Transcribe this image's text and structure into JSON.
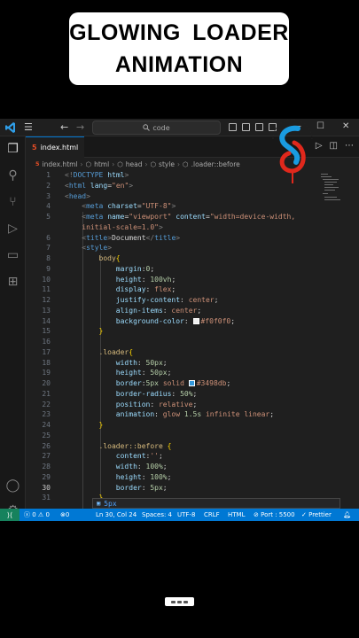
{
  "title": {
    "line1": "GLOWING  LOADER",
    "line2": "ANIMATION"
  },
  "titlebar": {
    "search_text": "code",
    "nav_back": "←",
    "nav_forward": "→"
  },
  "tab": {
    "label": "index.html",
    "icon": "html-file-icon"
  },
  "breadcrumb": [
    "index.html",
    "html",
    "head",
    "style",
    ".loader::before"
  ],
  "editor": {
    "lines": [
      {
        "n": "1",
        "cls": "",
        "html": "<span class=\"t-br\">&lt;!</span><span class=\"t-tag\">DOCTYPE</span> <span class=\"t-attr\">html</span><span class=\"t-br\">&gt;</span>"
      },
      {
        "n": "2",
        "cls": "",
        "html": "<span class=\"t-br\">&lt;</span><span class=\"t-tag\">html</span> <span class=\"t-attr\">lang</span><span class=\"t-txt\">=</span><span class=\"t-str\">\"en\"</span><span class=\"t-br\">&gt;</span>"
      },
      {
        "n": "3",
        "cls": "",
        "html": "<span class=\"t-br\">&lt;</span><span class=\"t-tag\">head</span><span class=\"t-br\">&gt;</span>"
      },
      {
        "n": "4",
        "cls": "",
        "html": "    <span class=\"t-br\">&lt;</span><span class=\"t-tag\">meta</span> <span class=\"t-attr\">charset</span><span class=\"t-txt\">=</span><span class=\"t-str\">\"UTF-8\"</span><span class=\"t-br\">&gt;</span>"
      },
      {
        "n": "5",
        "cls": "",
        "html": "    <span class=\"t-br\">&lt;</span><span class=\"t-tag\">meta</span> <span class=\"t-attr\">name</span><span class=\"t-txt\">=</span><span class=\"t-str\">\"viewport\"</span> <span class=\"t-attr\">content</span><span class=\"t-txt\">=</span><span class=\"t-str\">\"width=device-width,</span>"
      },
      {
        "n": "",
        "cls": "",
        "html": "    <span class=\"t-str\">initial-scale=1.0\"</span><span class=\"t-br\">&gt;</span>"
      },
      {
        "n": "6",
        "cls": "",
        "html": "    <span class=\"t-br\">&lt;</span><span class=\"t-tag\">title</span><span class=\"t-br\">&gt;</span><span class=\"t-txt\">Document</span><span class=\"t-br\">&lt;/</span><span class=\"t-tag\">title</span><span class=\"t-br\">&gt;</span>"
      },
      {
        "n": "7",
        "cls": "",
        "html": "    <span class=\"t-br\">&lt;</span><span class=\"t-tag\">style</span><span class=\"t-br\">&gt;</span>"
      },
      {
        "n": "8",
        "cls": "",
        "html": "        <span class=\"t-sel\">body</span><span class=\"t-brace\">{</span>"
      },
      {
        "n": "9",
        "cls": "",
        "html": "            <span class=\"t-prop\">margin</span><span class=\"t-txt\">:</span><span class=\"t-num\">0</span><span class=\"t-txt\">;</span>"
      },
      {
        "n": "10",
        "cls": "",
        "html": "            <span class=\"t-prop\">height</span><span class=\"t-txt\">: </span><span class=\"t-num\">100vh</span><span class=\"t-txt\">;</span>"
      },
      {
        "n": "11",
        "cls": "",
        "html": "            <span class=\"t-prop\">display</span><span class=\"t-txt\">: </span><span class=\"t-val\">flex</span><span class=\"t-txt\">;</span>"
      },
      {
        "n": "12",
        "cls": "",
        "html": "            <span class=\"t-prop\">justify-content</span><span class=\"t-txt\">: </span><span class=\"t-val\">center</span><span class=\"t-txt\">;</span>"
      },
      {
        "n": "13",
        "cls": "",
        "html": "            <span class=\"t-prop\">align-items</span><span class=\"t-txt\">: </span><span class=\"t-val\">center</span><span class=\"t-txt\">;</span>"
      },
      {
        "n": "14",
        "cls": "",
        "html": "            <span class=\"t-prop\">background-color</span><span class=\"t-txt\">: </span><span class=\"swatch\" style=\"background:#f0f0f0\"></span><span class=\"t-val\">#f0f0f0</span><span class=\"t-txt\">;</span>"
      },
      {
        "n": "15",
        "cls": "",
        "html": "        <span class=\"t-brace\">}</span>"
      },
      {
        "n": "16",
        "cls": "",
        "html": ""
      },
      {
        "n": "17",
        "cls": "",
        "html": "        <span class=\"t-sel\">.loader</span><span class=\"t-brace\">{</span>"
      },
      {
        "n": "18",
        "cls": "",
        "html": "            <span class=\"t-prop\">width</span><span class=\"t-txt\">: </span><span class=\"t-num\">50px</span><span class=\"t-txt\">;</span>"
      },
      {
        "n": "19",
        "cls": "",
        "html": "            <span class=\"t-prop\">height</span><span class=\"t-txt\">: </span><span class=\"t-num\">50px</span><span class=\"t-txt\">;</span>"
      },
      {
        "n": "20",
        "cls": "",
        "html": "            <span class=\"t-prop\">border</span><span class=\"t-txt\">:</span><span class=\"t-num\">5px</span> <span class=\"t-val\">solid</span> <span class=\"swatch\" style=\"background:#3498db\"></span><span class=\"t-val\">#3498db</span><span class=\"t-txt\">;</span>"
      },
      {
        "n": "21",
        "cls": "",
        "html": "            <span class=\"t-prop\">border-radius</span><span class=\"t-txt\">: </span><span class=\"t-num\">50%</span><span class=\"t-txt\">;</span>"
      },
      {
        "n": "22",
        "cls": "",
        "html": "            <span class=\"t-prop\">position</span><span class=\"t-txt\">: </span><span class=\"t-val\">relative</span><span class=\"t-txt\">;</span>"
      },
      {
        "n": "23",
        "cls": "",
        "html": "            <span class=\"t-prop\">animation</span><span class=\"t-txt\">: </span><span class=\"t-val\">glow</span> <span class=\"t-num\">1.5s</span> <span class=\"t-val\">infinite</span> <span class=\"t-val\">linear</span><span class=\"t-txt\">;</span>"
      },
      {
        "n": "24",
        "cls": "",
        "html": "        <span class=\"t-brace\">}</span>"
      },
      {
        "n": "25",
        "cls": "",
        "html": ""
      },
      {
        "n": "26",
        "cls": "",
        "html": "        <span class=\"t-sel\">.loader::before</span> <span class=\"t-brace\">{</span>"
      },
      {
        "n": "27",
        "cls": "",
        "html": "            <span class=\"t-prop\">content</span><span class=\"t-txt\">:</span><span class=\"t-str\">''</span><span class=\"t-txt\">;</span>"
      },
      {
        "n": "28",
        "cls": "",
        "html": "            <span class=\"t-prop\">width</span><span class=\"t-txt\">: </span><span class=\"t-num\">100%</span><span class=\"t-txt\">;</span>"
      },
      {
        "n": "29",
        "cls": "",
        "html": "            <span class=\"t-prop\">height</span><span class=\"t-txt\">: </span><span class=\"t-num\">100%</span><span class=\"t-txt\">;</span>"
      },
      {
        "n": "30",
        "cls": "cur",
        "html": "            <span class=\"t-prop\">border</span><span class=\"t-txt\">: </span><span class=\"t-num\">5px</span><span class=\"t-txt\">;</span>"
      },
      {
        "n": "31",
        "cls": "",
        "html": "        <span class=\"t-brace\">}</span>"
      }
    ],
    "suggestion": "5px"
  },
  "statusbar": {
    "errors": "0",
    "warnings": "0",
    "ports_forwarded": "0",
    "position": "Ln 30, Col 24",
    "spaces": "Spaces: 4",
    "encoding": "UTF-8",
    "eol": "CRLF",
    "language": "HTML",
    "port": "Port : 5500",
    "formatter": "Prettier"
  },
  "colors": {
    "accent": "#0078d4",
    "swatch_bg": "#f0f0f0",
    "swatch_blue": "#3498db",
    "logo_red": "#e0281c",
    "logo_blue": "#1a9be0"
  }
}
